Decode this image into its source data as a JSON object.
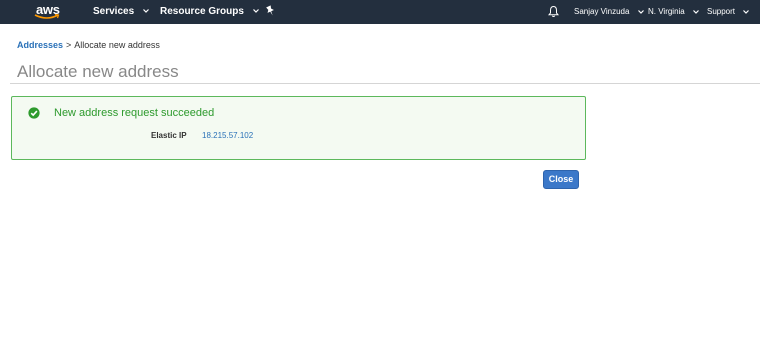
{
  "header": {
    "logo_text": "aws",
    "services_label": "Services",
    "resource_groups_label": "Resource Groups",
    "user_name": "Sanjay Vinzuda",
    "region": "N. Virginia",
    "support_label": "Support",
    "icons": [
      "pin-icon",
      "bell-icon",
      "chevron-down-icon"
    ]
  },
  "breadcrumb": {
    "link_label": "Addresses",
    "separator": ">",
    "current": "Allocate new address"
  },
  "page": {
    "title": "Allocate new address"
  },
  "result": {
    "message": "New address request succeeded",
    "field_label": "Elastic IP",
    "field_value": "18.215.57.102",
    "status_color": "#2d9a2d"
  },
  "actions": {
    "close_label": "Close"
  },
  "colors": {
    "nav_background": "#232f3e",
    "link": "#2a71b8",
    "primary_button": "#3b78c9",
    "success_border": "#5cb85c"
  }
}
